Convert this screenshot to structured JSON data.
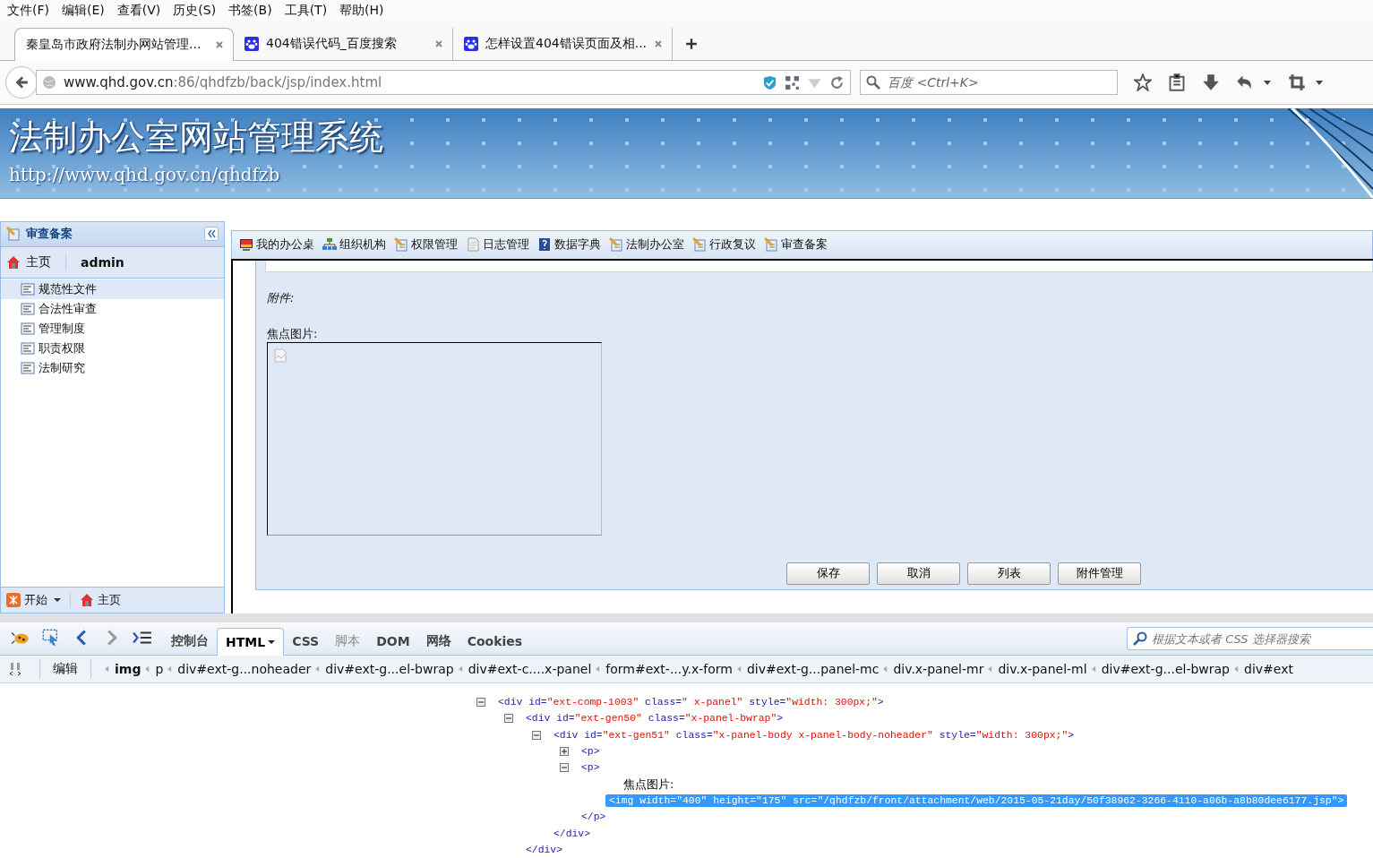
{
  "menu": [
    "文件(F)",
    "编辑(E)",
    "查看(V)",
    "历史(S)",
    "书签(B)",
    "工具(T)",
    "帮助(H)"
  ],
  "tabs": [
    {
      "title": "秦皇岛市政府法制办网站管理...",
      "selected": true,
      "kind": "page"
    },
    {
      "title": "404错误代码_百度搜索",
      "selected": false,
      "kind": "baidu"
    },
    {
      "title": "怎样设置404错误页面及相...",
      "selected": false,
      "kind": "baidu"
    }
  ],
  "address": {
    "host": "www.qhd.gov.cn",
    "path": ":86/qhdfzb/back/jsp/index.html"
  },
  "search": {
    "placeholder": "百度 <Ctrl+K>"
  },
  "banner": {
    "title": "法制办公室网站管理系统",
    "url": "http://www.qhd.gov.cn/qhdfzb"
  },
  "sidebar": {
    "title": "审查备案",
    "home": "主页",
    "user": "admin",
    "items": [
      {
        "label": "规范性文件",
        "selected": true
      },
      {
        "label": "合法性审查",
        "selected": false
      },
      {
        "label": "管理制度",
        "selected": false
      },
      {
        "label": "职责权限",
        "selected": false
      },
      {
        "label": "法制研究",
        "selected": false
      }
    ],
    "footer": {
      "start": "开始",
      "home": "主页"
    }
  },
  "toolbar": [
    {
      "label": "我的办公桌",
      "kind": "monitor"
    },
    {
      "label": "组织机构",
      "kind": "org"
    },
    {
      "label": "权限管理",
      "kind": "doc"
    },
    {
      "label": "日志管理",
      "kind": "log"
    },
    {
      "label": "数据字典",
      "kind": "dict"
    },
    {
      "label": "法制办公室",
      "kind": "doc"
    },
    {
      "label": "行政复议",
      "kind": "doc"
    },
    {
      "label": "审查备案",
      "kind": "doc"
    }
  ],
  "form": {
    "attachment_label": "附件:",
    "image_label": "焦点图片:",
    "buttons": [
      "保存",
      "取消",
      "列表",
      "附件管理"
    ]
  },
  "devtools": {
    "tabs": [
      {
        "label": "控制台",
        "selected": false,
        "disabled": false
      },
      {
        "label": "HTML",
        "selected": true,
        "disabled": false
      },
      {
        "label": "CSS",
        "selected": false,
        "disabled": false
      },
      {
        "label": "脚本",
        "selected": false,
        "disabled": true
      },
      {
        "label": "DOM",
        "selected": false,
        "disabled": false
      },
      {
        "label": "网络",
        "selected": false,
        "disabled": false
      },
      {
        "label": "Cookies",
        "selected": false,
        "disabled": false
      }
    ],
    "search": {
      "placeholder": "根据文本或者 CSS 选择器搜索"
    },
    "edit": "编辑",
    "breadcrumb": [
      {
        "label": "img",
        "selected": true
      },
      {
        "label": "p",
        "selected": false
      },
      {
        "label": "div#ext-g...noheader",
        "selected": false
      },
      {
        "label": "div#ext-g...el-bwrap",
        "selected": false
      },
      {
        "label": "div#ext-c....x-panel",
        "selected": false
      },
      {
        "label": "form#ext-...y.x-form",
        "selected": false
      },
      {
        "label": "div#ext-g...panel-mc",
        "selected": false
      },
      {
        "label": "div.x-panel-mr",
        "selected": false
      },
      {
        "label": "div.x-panel-ml",
        "selected": false
      },
      {
        "label": "div#ext-g...el-bwrap",
        "selected": false
      },
      {
        "label": "div#ext",
        "selected": false
      }
    ],
    "code": [
      {
        "kind": "element",
        "expanded": true,
        "selected": false,
        "parts": [
          {
            "kind": "markup",
            "text": "<div id="
          },
          {
            "kind": "value",
            "text": "\"ext-comp-1003\""
          },
          {
            "kind": "markup",
            "text": " class="
          },
          {
            "kind": "value",
            "text": "\" x-panel\""
          },
          {
            "kind": "markup",
            "text": " style="
          },
          {
            "kind": "value",
            "text": "\"width: 300px;\""
          },
          {
            "kind": "markup",
            "text": ">"
          }
        ],
        "children": [
          {
            "kind": "element",
            "expanded": true,
            "selected": false,
            "parts": [
              {
                "kind": "markup",
                "text": "<div id="
              },
              {
                "kind": "value",
                "text": "\"ext-gen50\""
              },
              {
                "kind": "markup",
                "text": " class="
              },
              {
                "kind": "value",
                "text": "\"x-panel-bwrap\""
              },
              {
                "kind": "markup",
                "text": ">"
              }
            ],
            "children": [
              {
                "kind": "element",
                "expanded": true,
                "selected": false,
                "parts": [
                  {
                    "kind": "markup",
                    "text": "<div id="
                  },
                  {
                    "kind": "value",
                    "text": "\"ext-gen51\""
                  },
                  {
                    "kind": "markup",
                    "text": " class="
                  },
                  {
                    "kind": "value",
                    "text": "\"x-panel-body x-panel-body-noheader\""
                  },
                  {
                    "kind": "markup",
                    "text": " style="
                  },
                  {
                    "kind": "value",
                    "text": "\"width: 300px;\""
                  },
                  {
                    "kind": "markup",
                    "text": ">"
                  }
                ],
                "children": [
                  {
                    "kind": "element",
                    "expanded": false,
                    "selected": false,
                    "parts": [
                      {
                        "kind": "markup",
                        "text": "<p>"
                      }
                    ]
                  },
                  {
                    "kind": "element",
                    "expanded": true,
                    "selected": false,
                    "parts": [
                      {
                        "kind": "markup",
                        "text": "<p>"
                      }
                    ],
                    "children": [
                      {
                        "kind": "text",
                        "parts": [
                          {
                            "kind": "plain",
                            "text": "焦点图片:"
                          }
                        ]
                      },
                      {
                        "kind": "leaf",
                        "selected": true,
                        "parts": [
                          {
                            "kind": "markup",
                            "text": "<img width="
                          },
                          {
                            "kind": "value",
                            "text": "\"400\""
                          },
                          {
                            "kind": "markup",
                            "text": " height="
                          },
                          {
                            "kind": "value",
                            "text": "\"175\""
                          },
                          {
                            "kind": "markup",
                            "text": " src="
                          },
                          {
                            "kind": "value",
                            "text": "\"/qhdfzb/front/attachment/web/2015-05-21day/50f38962-3266-4110-a06b-a8b80dee6177.jsp\""
                          },
                          {
                            "kind": "markup",
                            "text": ">"
                          }
                        ]
                      }
                    ]
                  },
                  {
                    "kind": "close",
                    "parts": [
                      {
                        "kind": "markup",
                        "text": "</p>"
                      }
                    ]
                  }
                ]
              },
              {
                "kind": "close",
                "parts": [
                  {
                    "kind": "markup",
                    "text": "</div>"
                  }
                ]
              }
            ]
          },
          {
            "kind": "close",
            "parts": [
              {
                "kind": "markup",
                "text": "</div>"
              }
            ]
          }
        ]
      }
    ]
  }
}
